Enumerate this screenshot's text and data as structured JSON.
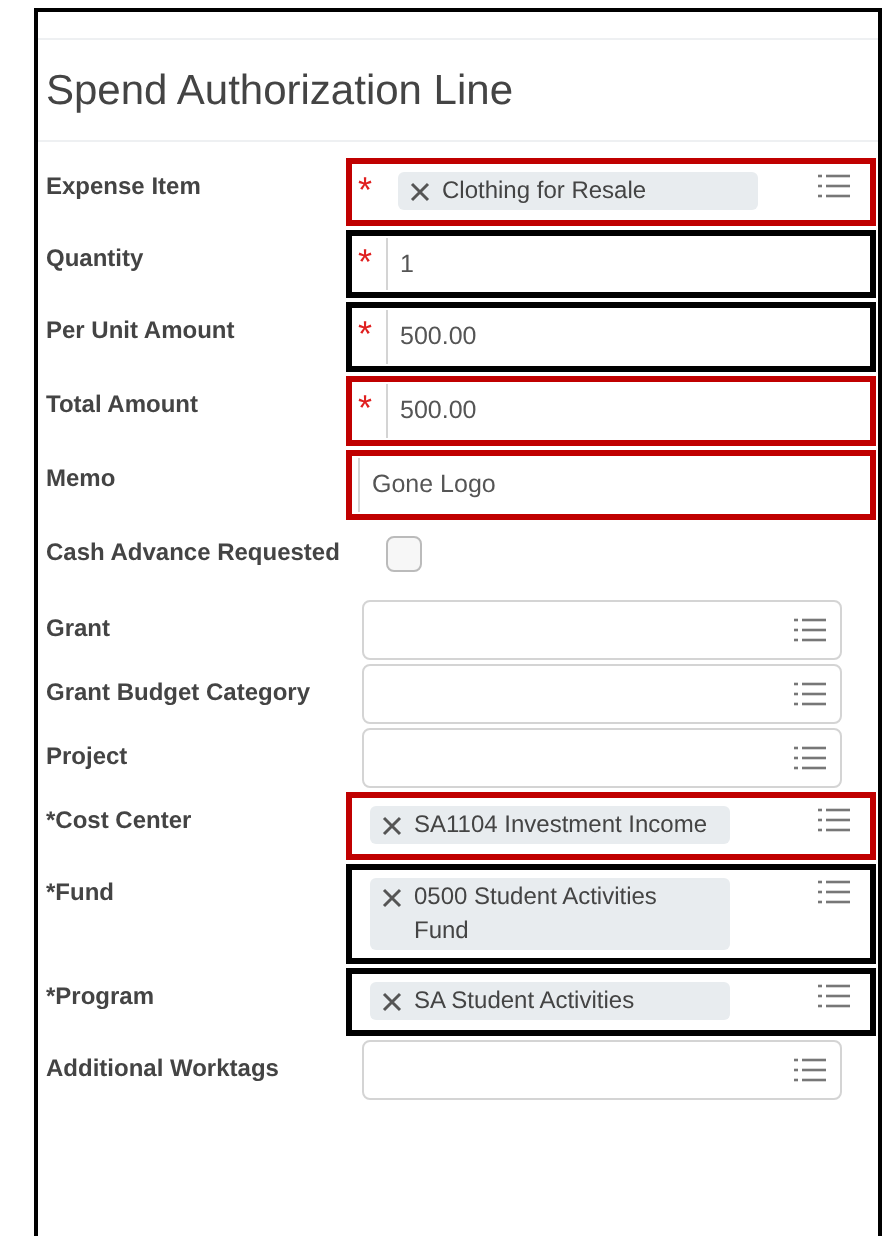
{
  "title": "Spend Authorization Line",
  "fields": [
    {
      "label": "Expense Item",
      "kind": "select",
      "asterisk": "*",
      "color": "#c00000",
      "chips": [
        "Clothing for Resale"
      ]
    },
    {
      "label": "Quantity",
      "kind": "text",
      "asterisk": "*",
      "color": "#000000",
      "value": "1"
    },
    {
      "label": "Per Unit Amount",
      "kind": "text",
      "asterisk": "*",
      "color": "#000000",
      "value": "500.00"
    },
    {
      "label": "Total Amount",
      "kind": "text",
      "asterisk": "*",
      "color": "#c00000",
      "value": "500.00"
    },
    {
      "label": "Memo",
      "kind": "text",
      "color": "#c00000",
      "value": "Gone Logo"
    },
    {
      "label": "Cash Advance Requested",
      "kind": "checkbox",
      "checked": false
    },
    {
      "label": "Grant",
      "kind": "select"
    },
    {
      "label": "Grant Budget Category",
      "kind": "select"
    },
    {
      "label": "Project",
      "kind": "select"
    },
    {
      "label": "*Cost Center",
      "kind": "select",
      "color": "#c00000",
      "chips": [
        "SA1104 Investment Income"
      ]
    },
    {
      "label": "*Fund",
      "kind": "select",
      "color": "#000000",
      "chips": [
        "0500 Student Activities Fund"
      ]
    },
    {
      "label": "*Program",
      "kind": "select",
      "color": "#000000",
      "chips": [
        "SA Student Activities"
      ]
    },
    {
      "label": "Additional Worktags",
      "kind": "select"
    }
  ]
}
